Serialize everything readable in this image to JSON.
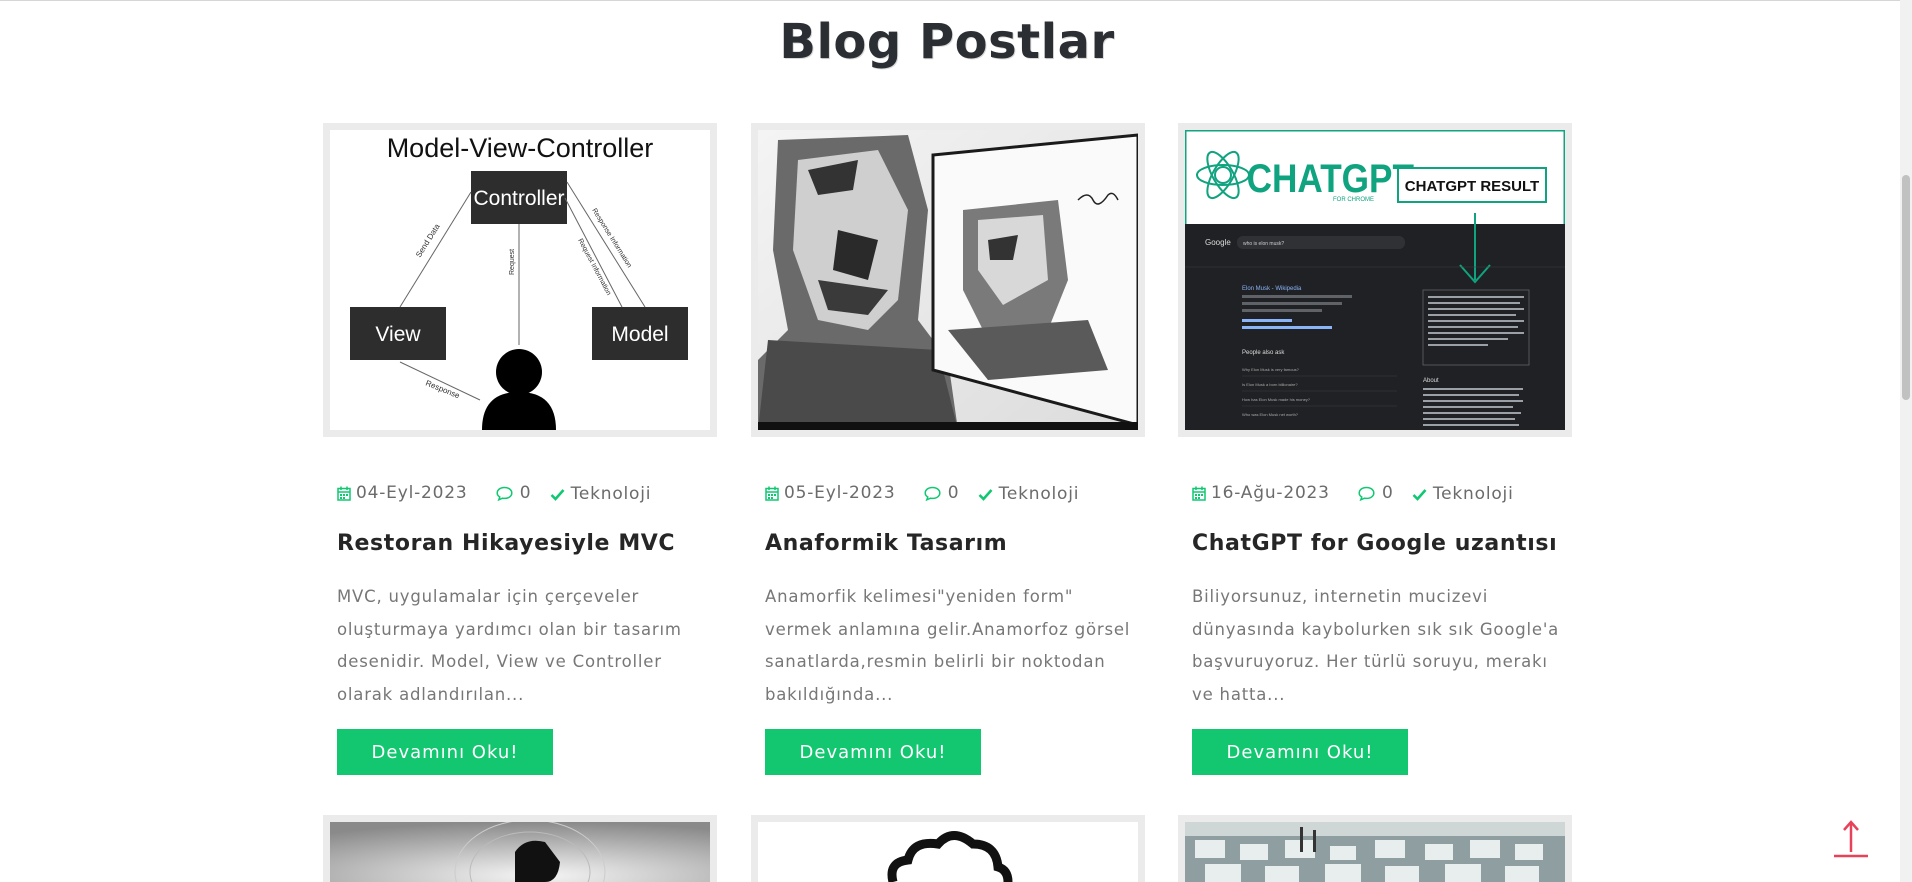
{
  "section": {
    "title": "Blog Postlar"
  },
  "mvc_image": {
    "title": "Model-View-Controller",
    "controller": "Controller",
    "view": "View",
    "model": "Model",
    "send_data": "Send Data",
    "response_info": "Response Information",
    "request_info": "Request Information",
    "request": "Request",
    "response": "Response"
  },
  "chatgpt_image": {
    "logo": "CHATGPT",
    "logo_sub": "FOR CHROME",
    "result_label": "CHATGPT RESULT",
    "search_query": "who is elon musk?",
    "google": "Google",
    "result_title": "Elon Musk - Wikipedia",
    "people_also_ask": "People also ask",
    "questions": [
      "Why Elon Musk is very famous?",
      "Is Elon Musk a born billionaire?",
      "How has Elon Musk made his money?",
      "Who was Elon Musk net worth?"
    ],
    "about": "About"
  },
  "posts": [
    {
      "date": "04-Eyl-2023",
      "comments": "0",
      "category": "Teknoloji",
      "title": "Restoran Hikayesiyle MVC",
      "excerpt": "MVC, uygulamalar için çerçeveler oluşturmaya yardımcı olan bir tasarım desenidir. Model, View ve Controller olarak adlandırılan...",
      "button": "Devamını Oku!"
    },
    {
      "date": "05-Eyl-2023",
      "comments": "0",
      "category": "Teknoloji",
      "title": "Anaformik Tasarım",
      "excerpt": "Anamorfik kelimesi\"yeniden form\" vermek anlamına gelir.Anamorfoz görsel sanatlarda,resmin belirli bir noktodan bakıldığında...",
      "button": "Devamını Oku!"
    },
    {
      "date": "16-Ağu-2023",
      "comments": "0",
      "category": "Teknoloji",
      "title": "ChatGPT for Google uzantısı",
      "excerpt": "Biliyorsunuz, internetin mucizevi dünyasında kaybolurken sık sık Google'a başvuruyoruz. Her türlü soruyu, merakı ve hatta...",
      "button": "Devamını Oku!"
    }
  ],
  "colors": {
    "accent": "#12c76f",
    "title": "#2b2f33",
    "scroll_top": "#e8425a"
  }
}
